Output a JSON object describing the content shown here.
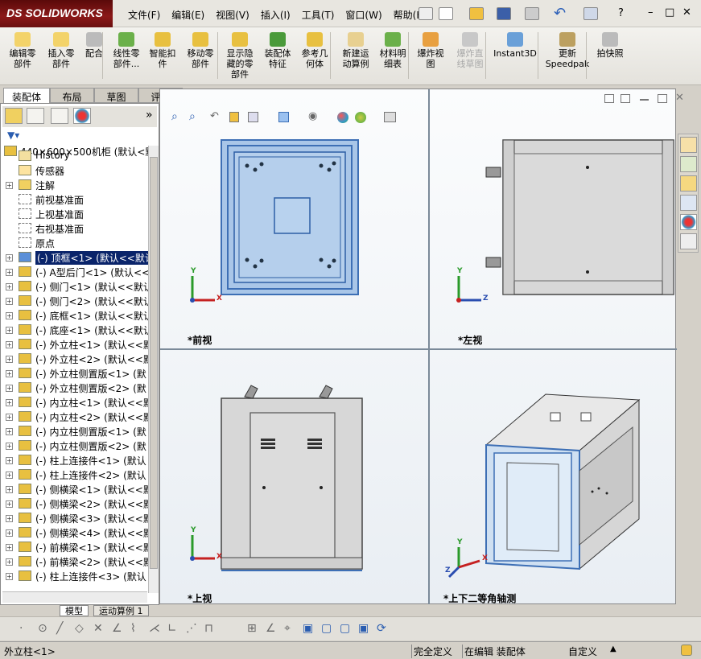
{
  "app": {
    "brand_prefix": "DS",
    "brand": "SOLIDWORKS"
  },
  "menu": [
    "文件(F)",
    "编辑(E)",
    "视图(V)",
    "插入(I)",
    "工具(T)",
    "窗口(W)",
    "帮助(H)"
  ],
  "help_symbol": "?",
  "window_controls": {
    "minimize": "–",
    "restore": "□",
    "close": "✕"
  },
  "commands": [
    {
      "label": "编辑零\n部件",
      "disabled": false
    },
    {
      "label": "插入零\n部件",
      "disabled": false
    },
    {
      "label": "配合",
      "disabled": false
    },
    {
      "label": "线性零\n部件...",
      "disabled": false
    },
    {
      "label": "智能扣\n件",
      "disabled": false
    },
    {
      "label": "移动零\n部件",
      "disabled": false
    },
    {
      "label": "显示隐\n藏的零\n部件",
      "disabled": false
    },
    {
      "label": "装配体\n特征",
      "disabled": false
    },
    {
      "label": "参考几\n何体",
      "disabled": false
    },
    {
      "label": "新建运\n动算例",
      "disabled": false
    },
    {
      "label": "材料明\n细表",
      "disabled": false
    },
    {
      "label": "爆炸视\n图",
      "disabled": false
    },
    {
      "label": "爆炸直\n线草图",
      "disabled": true
    },
    {
      "label": "Instant3D",
      "disabled": false
    },
    {
      "label": "更新\nSpeedpak",
      "disabled": false
    },
    {
      "label": "拍快照",
      "disabled": false
    }
  ],
  "tabs": [
    "装配体",
    "布局",
    "草图",
    "评估"
  ],
  "active_tab": "装配体",
  "tree": {
    "root": "440×600×500机柜  (默认<默",
    "items": [
      {
        "label": "History",
        "type": "history",
        "expandable": false
      },
      {
        "label": "传感器",
        "type": "sensor",
        "expandable": false
      },
      {
        "label": "注解",
        "type": "annotation",
        "expandable": true
      },
      {
        "label": "前视基准面",
        "type": "plane",
        "expandable": false
      },
      {
        "label": "上视基准面",
        "type": "plane",
        "expandable": false
      },
      {
        "label": "右视基准面",
        "type": "plane",
        "expandable": false
      },
      {
        "label": "原点",
        "type": "origin",
        "expandable": false
      },
      {
        "label": "(-) 顶框<1> (默认<<默认",
        "type": "part",
        "expandable": true,
        "selected": true
      },
      {
        "label": "(-) A型后门<1> (默认<<默",
        "type": "part",
        "expandable": true
      },
      {
        "label": "(-) 侧门<1> (默认<<默认",
        "type": "part",
        "expandable": true
      },
      {
        "label": "(-) 侧门<2> (默认<<默认",
        "type": "part",
        "expandable": true
      },
      {
        "label": "(-) 底框<1> (默认<<默认",
        "type": "part",
        "expandable": true
      },
      {
        "label": "(-) 底座<1> (默认<<默认",
        "type": "part",
        "expandable": true
      },
      {
        "label": "(-) 外立柱<1> (默认<<默",
        "type": "part",
        "expandable": true
      },
      {
        "label": "(-) 外立柱<2> (默认<<默",
        "type": "part",
        "expandable": true
      },
      {
        "label": "(-) 外立柱侧置版<1> (默",
        "type": "part",
        "expandable": true
      },
      {
        "label": "(-) 外立柱侧置版<2> (默",
        "type": "part",
        "expandable": true
      },
      {
        "label": "(-) 内立柱<1> (默认<<默",
        "type": "part",
        "expandable": true
      },
      {
        "label": "(-) 内立柱<2> (默认<<默",
        "type": "part",
        "expandable": true
      },
      {
        "label": "(-) 内立柱侧置版<1> (默",
        "type": "part",
        "expandable": true
      },
      {
        "label": "(-) 内立柱侧置版<2> (默",
        "type": "part",
        "expandable": true
      },
      {
        "label": "(-) 柱上连接件<1> (默认",
        "type": "part",
        "expandable": true
      },
      {
        "label": "(-) 柱上连接件<2> (默认",
        "type": "part",
        "expandable": true
      },
      {
        "label": "(-) 侧横梁<1> (默认<<默",
        "type": "part",
        "expandable": true
      },
      {
        "label": "(-) 侧横梁<2> (默认<<默",
        "type": "part",
        "expandable": true
      },
      {
        "label": "(-) 侧横梁<3> (默认<<默",
        "type": "part",
        "expandable": true
      },
      {
        "label": "(-) 侧横梁<4> (默认<<默",
        "type": "part",
        "expandable": true
      },
      {
        "label": "(-) 前横梁<1> (默认<<默",
        "type": "part",
        "expandable": true
      },
      {
        "label": "(-) 前横梁<2> (默认<<默",
        "type": "part",
        "expandable": true
      },
      {
        "label": "(-) 柱上连接件<3> (默认",
        "type": "part",
        "expandable": true
      }
    ]
  },
  "panel_tabs": [
    "模型",
    "运动算例 1"
  ],
  "views": {
    "front": "*前视",
    "left": "*左视",
    "top": "*上视",
    "iso": "*上下二等角轴测"
  },
  "triad": {
    "x": "X",
    "y": "Y",
    "z": "Z"
  },
  "status": {
    "selection": "外立柱<1>",
    "definition": "完全定义",
    "editing": "在编辑 装配体",
    "units": "自定义"
  },
  "colors": {
    "selected_part": "#a9c6e8",
    "part_edge": "#3d6fb5",
    "body_gray": "#d7d7d7",
    "selection_bg": "#0a246a",
    "brand_red": "#7a1212"
  }
}
